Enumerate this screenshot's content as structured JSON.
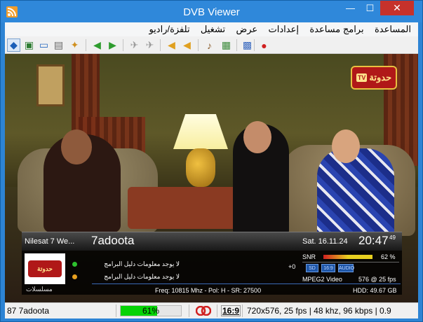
{
  "window": {
    "title": "DVB Viewer",
    "min_glyph": "—",
    "max_glyph": "☐",
    "close_glyph": "✕"
  },
  "menu": [
    "المساعدة",
    "برامج مساعدة",
    "إعدادات",
    "عرض",
    "تشغيل",
    "تلفزة/راديو"
  ],
  "toolbar": [
    {
      "name": "osd-icon",
      "glyph": "◆",
      "color": "#1B5FB8",
      "active": true
    },
    {
      "name": "picture-icon",
      "glyph": "▣",
      "color": "#2E7D32"
    },
    {
      "name": "window-icon",
      "glyph": "▭",
      "color": "#2A6AC0"
    },
    {
      "name": "teletext-icon",
      "glyph": "▤",
      "color": "#666666"
    },
    {
      "name": "favorites-icon",
      "glyph": "✦",
      "color": "#D09020"
    },
    {
      "name": "back-icon",
      "glyph": "◀",
      "color": "#2E9C2E"
    },
    {
      "name": "forward-icon",
      "glyph": "▶",
      "color": "#2E9C2E"
    },
    {
      "name": "prev-channel-icon",
      "glyph": "✈",
      "color": "#9A9A9A"
    },
    {
      "name": "next-channel-icon",
      "glyph": "✈",
      "color": "#9A9A9A"
    },
    {
      "name": "volume-down-icon",
      "glyph": "◀",
      "color": "#E0A020"
    },
    {
      "name": "volume-up-icon",
      "glyph": "◀",
      "color": "#E0A020"
    },
    {
      "name": "audio-track-icon",
      "glyph": "♪",
      "color": "#8A5A2A"
    },
    {
      "name": "snapshot-icon",
      "glyph": "▦",
      "color": "#3A8A3A"
    },
    {
      "name": "epg-icon",
      "glyph": "▩",
      "color": "#3A6AC0"
    },
    {
      "name": "record-icon",
      "glyph": "●",
      "color": "#D02020"
    }
  ],
  "video": {
    "logo_text": "حدوتة",
    "logo_tv": "TV"
  },
  "osd": {
    "satellite": "Nilesat 7 We...",
    "channel": "7adoota",
    "date": "Sat. 16.11.24",
    "time": "20:47",
    "seconds": "49",
    "logo_text": "حدوتة",
    "epg_now": "لا يوجد معلومات دليل البرامج",
    "epg_next": "لا يوجد معلومات دليل البرامج",
    "offset": "+0",
    "snr_label": "SNR",
    "snr_value": "62 %",
    "snr_level": 0.62,
    "badges": [
      "SD",
      "16:9",
      "AUDIO"
    ],
    "format": "MPEG2 Video",
    "resolution_fps": "576 @ 25 fps",
    "tuning": "Freq: 10815 Mhz - Pol: H - SR: 27500",
    "hdd": "HDD: 49.67 GB",
    "footer_text": "مسلسلات"
  },
  "status": {
    "channel": "87 7adoota",
    "signal_percent": "61%",
    "signal_level": 0.61,
    "aspect": "16:9",
    "stream_info": "720x576, 25 fps | 48 khz, 96 kbps | 0.9"
  }
}
